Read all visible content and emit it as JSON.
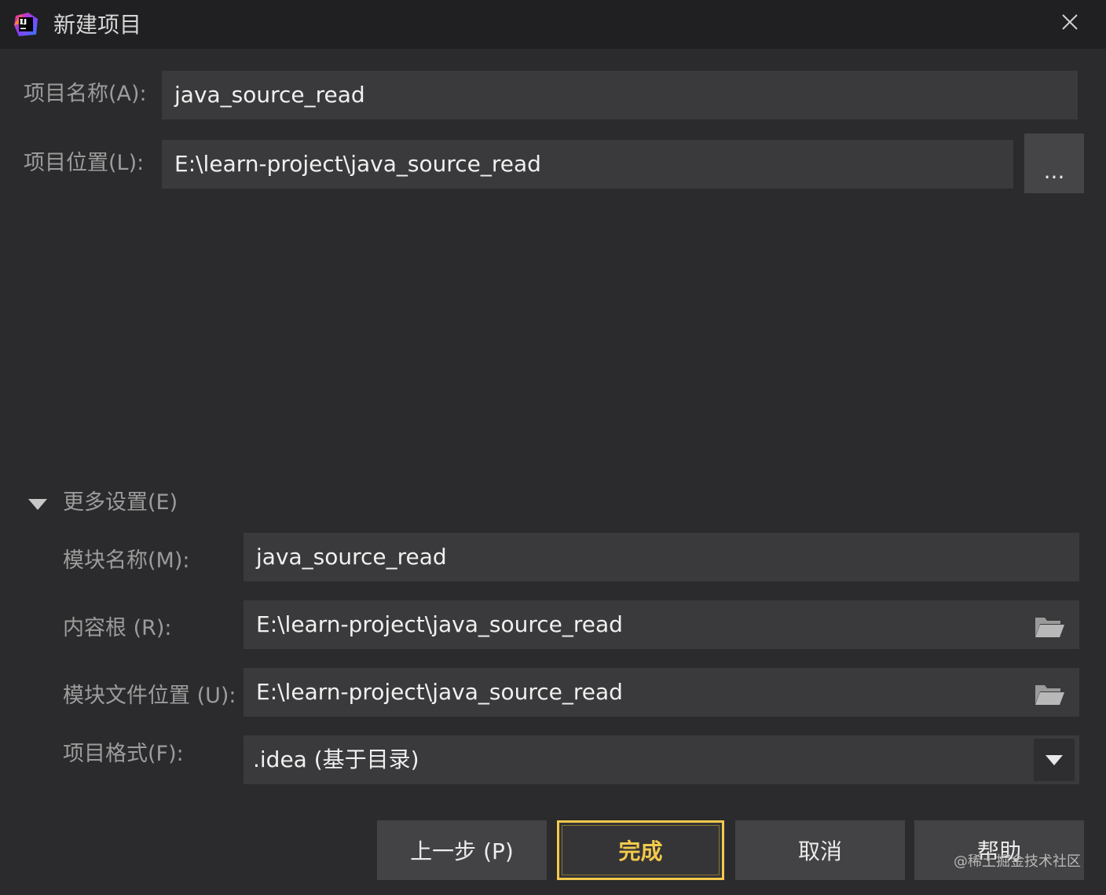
{
  "window": {
    "title": "新建项目",
    "logo_icon": "intellij-idea-icon",
    "close_icon": "close-icon"
  },
  "project": {
    "name_label": "项目名称(A):",
    "name_value": "java_source_read",
    "location_label": "项目位置(L):",
    "location_value": "E:\\learn-project\\java_source_read",
    "browse_label": "..."
  },
  "more_settings": {
    "toggle_label": "更多设置(E)",
    "expanded": true,
    "module_name_label": "模块名称(M):",
    "module_name_value": "java_source_read",
    "content_root_label": "内容根 (R):",
    "content_root_value": "E:\\learn-project\\java_source_read",
    "module_file_label": "模块文件位置 (U):",
    "module_file_value": "E:\\learn-project\\java_source_read",
    "format_label": "项目格式(F):",
    "format_value": ".idea (基于目录)",
    "folder_icon": "folder-open-icon"
  },
  "buttons": {
    "previous": "上一步 (P)",
    "finish": "完成",
    "cancel": "取消",
    "help": "帮助"
  },
  "watermark": "@稀土掘金技术社区",
  "colors": {
    "background": "#2b2b2d",
    "titlebar": "#202022",
    "field": "#3a3a3c",
    "accent": "#f2c94c"
  }
}
